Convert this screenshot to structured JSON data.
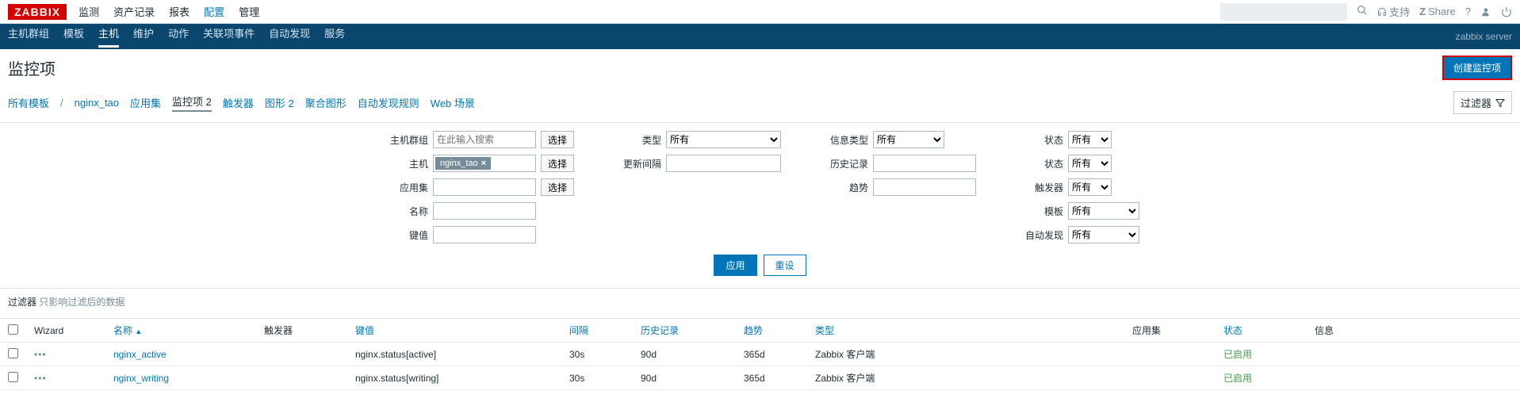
{
  "logo": "ZABBIX",
  "top_nav": [
    "监测",
    "资产记录",
    "报表",
    "配置",
    "管理"
  ],
  "top_nav_active": 3,
  "support_label": "支持",
  "share_label": "Share",
  "sub_nav": [
    "主机群组",
    "模板",
    "主机",
    "维护",
    "动作",
    "关联项事件",
    "自动发现",
    "服务"
  ],
  "sub_nav_active": 2,
  "server_label": "zabbix server",
  "page_title": "监控项",
  "create_btn": "创建监控项",
  "breadcrumb": {
    "all_templates": "所有模板",
    "host": "nginx_tao",
    "app_sets": "应用集",
    "items": "监控项 2",
    "triggers": "触发器",
    "graphs": "图形 2",
    "screens": "聚合图形",
    "discovery": "自动发现规则",
    "web": "Web 场景"
  },
  "filter_toggle": "过滤器",
  "filters": {
    "host_group": {
      "label": "主机群组",
      "placeholder": "在此输入搜索",
      "select": "选择"
    },
    "host": {
      "label": "主机",
      "chip": "nginx_tao",
      "select": "选择"
    },
    "app_set": {
      "label": "应用集",
      "select": "选择"
    },
    "name": {
      "label": "名称"
    },
    "key": {
      "label": "键值"
    },
    "type": {
      "label": "类型",
      "value": "所有"
    },
    "update_interval": {
      "label": "更新间隔"
    },
    "info_type": {
      "label": "信息类型",
      "value": "所有"
    },
    "history": {
      "label": "历史记录"
    },
    "trends": {
      "label": "趋势"
    },
    "status": {
      "label": "状态",
      "value": "所有"
    },
    "state": {
      "label": "状态",
      "value": "所有"
    },
    "triggers": {
      "label": "触发器",
      "value": "所有"
    },
    "template": {
      "label": "模板",
      "value": "所有"
    },
    "discovery": {
      "label": "自动发现",
      "value": "所有"
    }
  },
  "apply_btn": "应用",
  "reset_btn": "重设",
  "subfilter": {
    "label": "过滤器",
    "hint": "只影响过滤后的数据"
  },
  "table": {
    "headers": {
      "wizard": "Wizard",
      "name": "名称",
      "triggers": "触发器",
      "key": "键值",
      "interval": "间隔",
      "history": "历史记录",
      "trends": "趋势",
      "type": "类型",
      "app_set": "应用集",
      "status": "状态",
      "info": "信息"
    },
    "rows": [
      {
        "name": "nginx_active",
        "key": "nginx.status[active]",
        "interval": "30s",
        "history": "90d",
        "trends": "365d",
        "type": "Zabbix 客户端",
        "status": "已启用"
      },
      {
        "name": "nginx_writing",
        "key": "nginx.status[writing]",
        "interval": "30s",
        "history": "90d",
        "trends": "365d",
        "type": "Zabbix 客户端",
        "status": "已启用"
      }
    ]
  }
}
